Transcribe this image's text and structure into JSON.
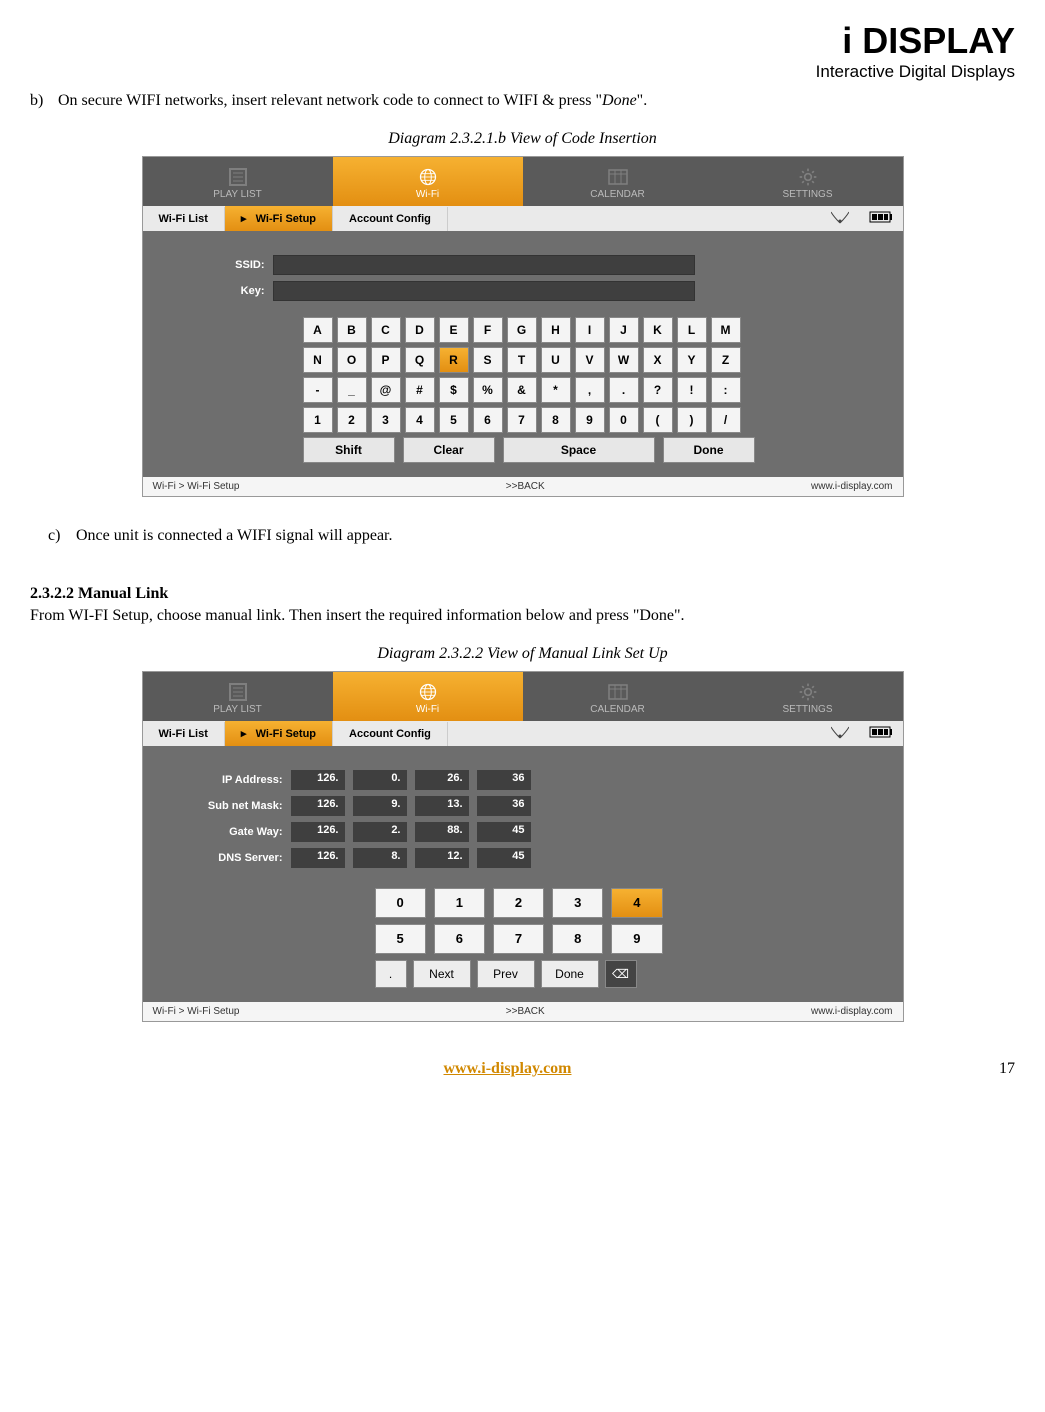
{
  "header": {
    "logo_main": "i DISPLAY",
    "logo_sub": "Interactive Digital Displays"
  },
  "instruction_b": {
    "idx": "b)",
    "text_before": "On secure WIFI networks, insert relevant network code to connect to WIFI & press \"",
    "done_word": "Done",
    "text_after": "\"."
  },
  "caption1": "Diagram 2.3.2.1.b    View of Code Insertion",
  "shot1": {
    "topnav": [
      "PLAY LIST",
      "Wi-Fi",
      "CALENDAR",
      "SETTINGS"
    ],
    "subnav": {
      "list": "Wi-Fi List",
      "setup": "Wi-Fi Setup",
      "account": "Account Config",
      "arrow": "▸"
    },
    "fields": {
      "ssid_label": "SSID:",
      "key_label": "Key:"
    },
    "keyboard": {
      "row1": [
        "A",
        "B",
        "C",
        "D",
        "E",
        "F",
        "G",
        "H",
        "I",
        "J",
        "K",
        "L",
        "M"
      ],
      "row2": [
        "N",
        "O",
        "P",
        "Q",
        "R",
        "S",
        "T",
        "U",
        "V",
        "W",
        "X",
        "Y",
        "Z"
      ],
      "row3": [
        "-",
        "_",
        "@",
        "#",
        "$",
        "%",
        "&",
        "*",
        ",",
        ".",
        "?",
        "!",
        ":"
      ],
      "row4": [
        "1",
        "2",
        "3",
        "4",
        "5",
        "6",
        "7",
        "8",
        "9",
        "0",
        "(",
        ")",
        "/"
      ],
      "selected": "R",
      "actions": {
        "shift": "Shift",
        "clear": "Clear",
        "space": "Space",
        "done": "Done"
      }
    },
    "footer": {
      "left": "Wi-Fi > Wi-Fi Setup",
      "mid": ">>BACK",
      "right": "www.i-display.com"
    }
  },
  "instruction_c": {
    "idx": "c)",
    "text": "Once unit is connected a WIFI signal will appear."
  },
  "section": {
    "head": "2.3.2.2 Manual Link",
    "body": "From WI-FI Setup, choose manual link. Then insert the required information below and press \"Done\"."
  },
  "caption2": "Diagram 2.3.2.2    View of Manual Link Set Up",
  "shot2": {
    "topnav": [
      "PLAY LIST",
      "Wi-Fi",
      "CALENDAR",
      "SETTINGS"
    ],
    "subnav": {
      "list": "Wi-Fi List",
      "setup": "Wi-Fi Setup",
      "account": "Account Config",
      "arrow": "▸"
    },
    "fields": [
      {
        "label": "IP Address:",
        "vals": [
          "126.",
          "0.",
          "26.",
          "36"
        ]
      },
      {
        "label": "Sub net Mask:",
        "vals": [
          "126.",
          "9.",
          "13.",
          "36"
        ]
      },
      {
        "label": "Gate Way:",
        "vals": [
          "126.",
          "2.",
          "88.",
          "45"
        ]
      },
      {
        "label": "DNS Server:",
        "vals": [
          "126.",
          "8.",
          "12.",
          "45"
        ]
      }
    ],
    "numpad": {
      "row1": [
        "0",
        "1",
        "2",
        "3",
        "4"
      ],
      "row2": [
        "5",
        "6",
        "7",
        "8",
        "9"
      ],
      "selected": "4",
      "ctrls": {
        "dot": ".",
        "next": "Next",
        "prev": "Prev",
        "done": "Done",
        "bs": "⌫"
      }
    },
    "footer": {
      "left": "Wi-Fi > Wi-Fi Setup",
      "mid": ">>BACK",
      "right": "www.i-display.com"
    }
  },
  "page": {
    "url": "www.i-display.com",
    "num": "17"
  }
}
